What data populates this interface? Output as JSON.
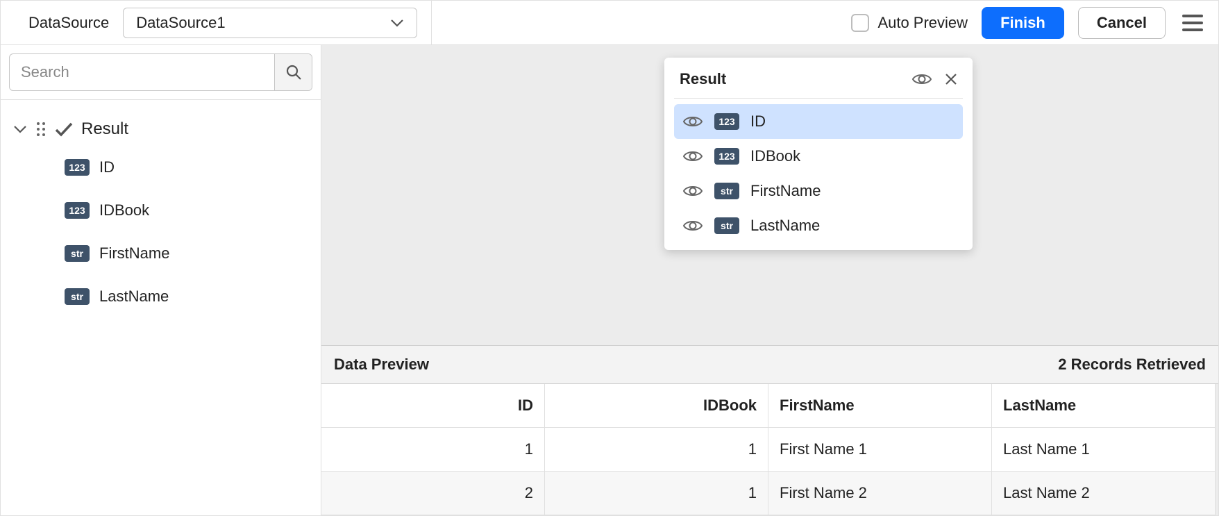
{
  "header": {
    "datasource_label": "DataSource",
    "datasource_selected": "DataSource1",
    "auto_preview_label": "Auto Preview",
    "finish_label": "Finish",
    "cancel_label": "Cancel"
  },
  "sidebar": {
    "search_placeholder": "Search",
    "root_label": "Result",
    "fields": [
      {
        "type": "num",
        "label": "ID"
      },
      {
        "type": "num",
        "label": "IDBook"
      },
      {
        "type": "str",
        "label": "FirstName"
      },
      {
        "type": "str",
        "label": "LastName"
      }
    ]
  },
  "preview_panel": {
    "title": "Result",
    "fields": [
      {
        "type": "num",
        "label": "ID",
        "selected": true
      },
      {
        "type": "num",
        "label": "IDBook",
        "selected": false
      },
      {
        "type": "str",
        "label": "FirstName",
        "selected": false
      },
      {
        "type": "str",
        "label": "LastName",
        "selected": false
      }
    ]
  },
  "data_preview": {
    "title": "Data Preview",
    "records_text": "2 Records Retrieved",
    "columns": [
      "ID",
      "IDBook",
      "FirstName",
      "LastName"
    ],
    "rows": [
      {
        "ID": "1",
        "IDBook": "1",
        "FirstName": "First Name 1",
        "LastName": "Last Name 1"
      },
      {
        "ID": "2",
        "IDBook": "1",
        "FirstName": "First Name 2",
        "LastName": "Last Name 2"
      }
    ]
  },
  "badges": {
    "num": "123",
    "str": "str"
  }
}
